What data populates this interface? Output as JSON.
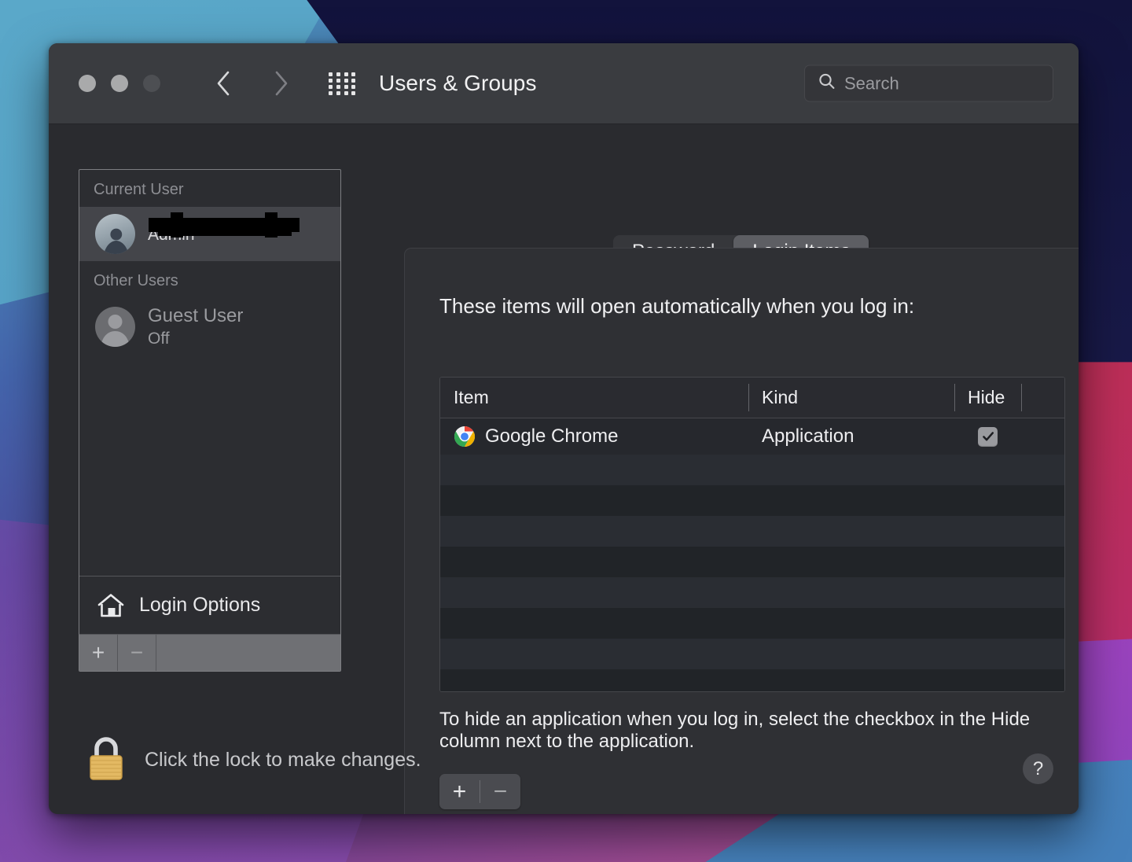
{
  "window": {
    "title": "Users & Groups",
    "traffic_lights": [
      "close-button",
      "minimize-button",
      "zoom-button"
    ],
    "back_label": "back",
    "forward_label": "forward",
    "grid_label": "show-all"
  },
  "search": {
    "placeholder": "Search",
    "value": "",
    "icon": "search-icon"
  },
  "sidebar": {
    "current_user_header": "Current User",
    "current_user": {
      "name": "",
      "role": "Admin",
      "redacted": true,
      "avatar": "user-photo-avatar"
    },
    "other_users_header": "Other Users",
    "other_users": [
      {
        "name": "Guest User",
        "status": "Off",
        "avatar": "generic-person-avatar"
      }
    ],
    "login_options_label": "Login Options",
    "login_options_icon": "home-icon",
    "add_label": "+",
    "remove_label": "−"
  },
  "tabs": [
    {
      "label": "Password",
      "active": false
    },
    {
      "label": "Login Items",
      "active": true
    }
  ],
  "main": {
    "heading": "These items will open automatically when you log in:",
    "table": {
      "columns": [
        "Item",
        "Kind",
        "Hide"
      ],
      "rows": [
        {
          "item": "Google Chrome",
          "icon": "chrome-icon",
          "kind": "Application",
          "hide": true
        }
      ],
      "empty_row_count": 8
    },
    "hint": "To hide an application when you log in, select the checkbox in the Hide column next to the application.",
    "add_label": "+",
    "remove_label": "−"
  },
  "footer": {
    "lock_text": "Click the lock to make changes.",
    "lock_icon": "closed-lock-icon",
    "help_label": "?"
  },
  "colors": {
    "window_body": "#2a2b2f",
    "titlebar": "#3a3c40",
    "panel": "#2f3034",
    "selection": "#44454a",
    "row_light": "#2a2d33",
    "row_dark": "#212428",
    "lock_gold": "#e8b75a"
  }
}
